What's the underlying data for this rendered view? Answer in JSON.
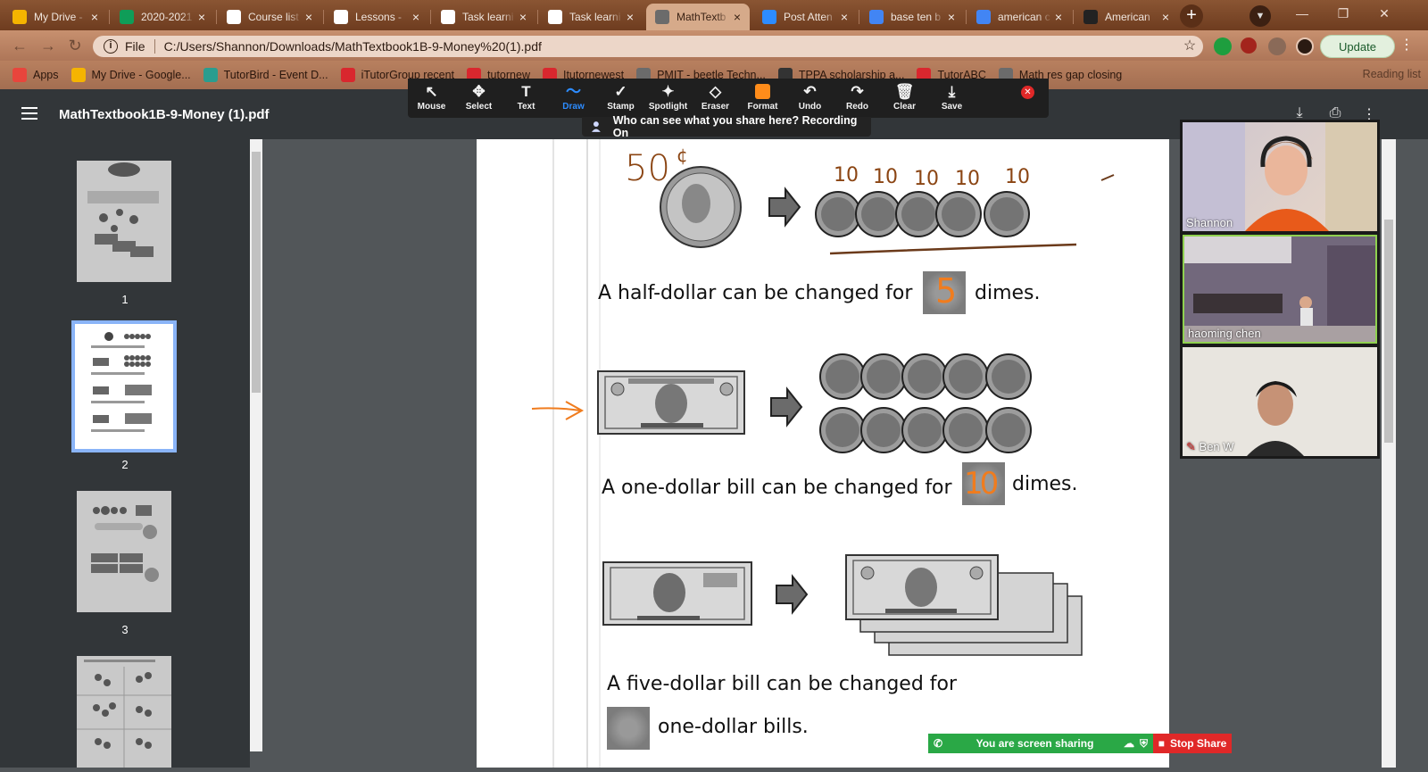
{
  "tabs": [
    {
      "title": "My Drive -",
      "icon": "google-drive-icon",
      "color": "#f5b400"
    },
    {
      "title": "2020-2021",
      "icon": "google-sheets-icon",
      "color": "#0f9d58"
    },
    {
      "title": "Course list",
      "icon": "doc-lock-icon",
      "color": "#ffffff"
    },
    {
      "title": "Lessons - ",
      "icon": "doc-lock-icon",
      "color": "#ffffff"
    },
    {
      "title": "Task learni",
      "icon": "doc-lock-icon",
      "color": "#ffffff"
    },
    {
      "title": "Task learni",
      "icon": "doc-lock-icon",
      "color": "#ffffff"
    },
    {
      "title": "MathTextb",
      "icon": "globe-icon",
      "color": "#6b6b6b"
    },
    {
      "title": "Post Atten",
      "icon": "zoom-icon",
      "color": "#2d8cff"
    },
    {
      "title": "base ten b",
      "icon": "google-icon",
      "color": "#4285f4"
    },
    {
      "title": "american c",
      "icon": "google-icon",
      "color": "#4285f4"
    },
    {
      "title": "American ",
      "icon": "is-logo-icon",
      "color": "#222222"
    }
  ],
  "active_tab_index": 6,
  "address": {
    "scheme_label": "File",
    "url": "C:/Users/Shannon/Downloads/MathTextbook1B-9-Money%20(1).pdf"
  },
  "update_label": "Update",
  "bookmarks": [
    {
      "label": "Apps",
      "icon": "apps-grid-icon",
      "color": "#e8453c"
    },
    {
      "label": "My Drive - Google...",
      "icon": "google-drive-icon",
      "color": "#f5b400"
    },
    {
      "label": "TutorBird - Event D...",
      "icon": "tutorbird-icon",
      "color": "#2a9d8f"
    },
    {
      "label": "iTutorGroup recent",
      "icon": "itutor-icon",
      "color": "#d9272e"
    },
    {
      "label": "tutornew",
      "icon": "itutor-icon",
      "color": "#d9272e"
    },
    {
      "label": "Itutornewest",
      "icon": "itutor-icon",
      "color": "#d9272e"
    },
    {
      "label": "PMIT - beetle Techn...",
      "icon": "globe-icon",
      "color": "#6b6b6b"
    },
    {
      "label": "TPPA scholarship a...",
      "icon": "paw-icon",
      "color": "#333333"
    },
    {
      "label": "TutorABC",
      "icon": "itutor-icon",
      "color": "#d9272e"
    },
    {
      "label": "Math res gap closing",
      "icon": "globe-icon",
      "color": "#6b6b6b"
    }
  ],
  "reading_list_label": "Reading list",
  "pdf": {
    "title": "MathTextbook1B-9-Money (1).pdf",
    "page_labels": [
      "1",
      "2",
      "3"
    ],
    "selected_page": 1
  },
  "zoom_toolbar": {
    "tools": [
      {
        "label": "Mouse",
        "icon": "cursor-icon",
        "glyph": "↖"
      },
      {
        "label": "Select",
        "icon": "move-icon",
        "glyph": "✥"
      },
      {
        "label": "Text",
        "icon": "text-icon",
        "glyph": "T"
      },
      {
        "label": "Draw",
        "icon": "squiggle-icon",
        "glyph": "〜"
      },
      {
        "label": "Stamp",
        "icon": "check-icon",
        "glyph": "✓"
      },
      {
        "label": "Spotlight",
        "icon": "wand-icon",
        "glyph": "✦"
      },
      {
        "label": "Eraser",
        "icon": "eraser-icon",
        "glyph": "◇"
      },
      {
        "label": "Format",
        "icon": "format-swatch-icon",
        "glyph": "■"
      },
      {
        "label": "Undo",
        "icon": "undo-icon",
        "glyph": "↶"
      },
      {
        "label": "Redo",
        "icon": "redo-icon",
        "glyph": "↷"
      },
      {
        "label": "Clear",
        "icon": "trash-icon",
        "glyph": "🗑"
      },
      {
        "label": "Save",
        "icon": "save-icon",
        "glyph": "⤓"
      }
    ],
    "active_tool": "Draw",
    "accent": "#2d8cff",
    "format_color": "#ff8c1a",
    "recording_banner": "Who can see what you share here? Recording On"
  },
  "worksheet": {
    "sentence1_before": "A half-dollar can be changed for",
    "sentence1_after": "dimes.",
    "sentence2_before": "A one-dollar bill can be changed for",
    "sentence2_after": "dimes.",
    "sentence3_line1": "A five-dollar bill can be changed for",
    "sentence3_line2": "one-dollar bills.",
    "handwriting": {
      "half_dollar_value": "50",
      "cent_mark": "¢",
      "dime_values": [
        "10",
        "10",
        "10",
        "10",
        "10"
      ],
      "answer1": "5",
      "answer2": "10",
      "ink_color": "#8b4513",
      "orange_ink": "#f07c1e"
    }
  },
  "participants": [
    {
      "name": "Shannon",
      "muted": false
    },
    {
      "name": "haoming   chen",
      "muted": false
    },
    {
      "name": "Ben W",
      "muted": true
    }
  ],
  "share_bar": {
    "status": "You are screen sharing",
    "stop_label": "Stop Share"
  }
}
